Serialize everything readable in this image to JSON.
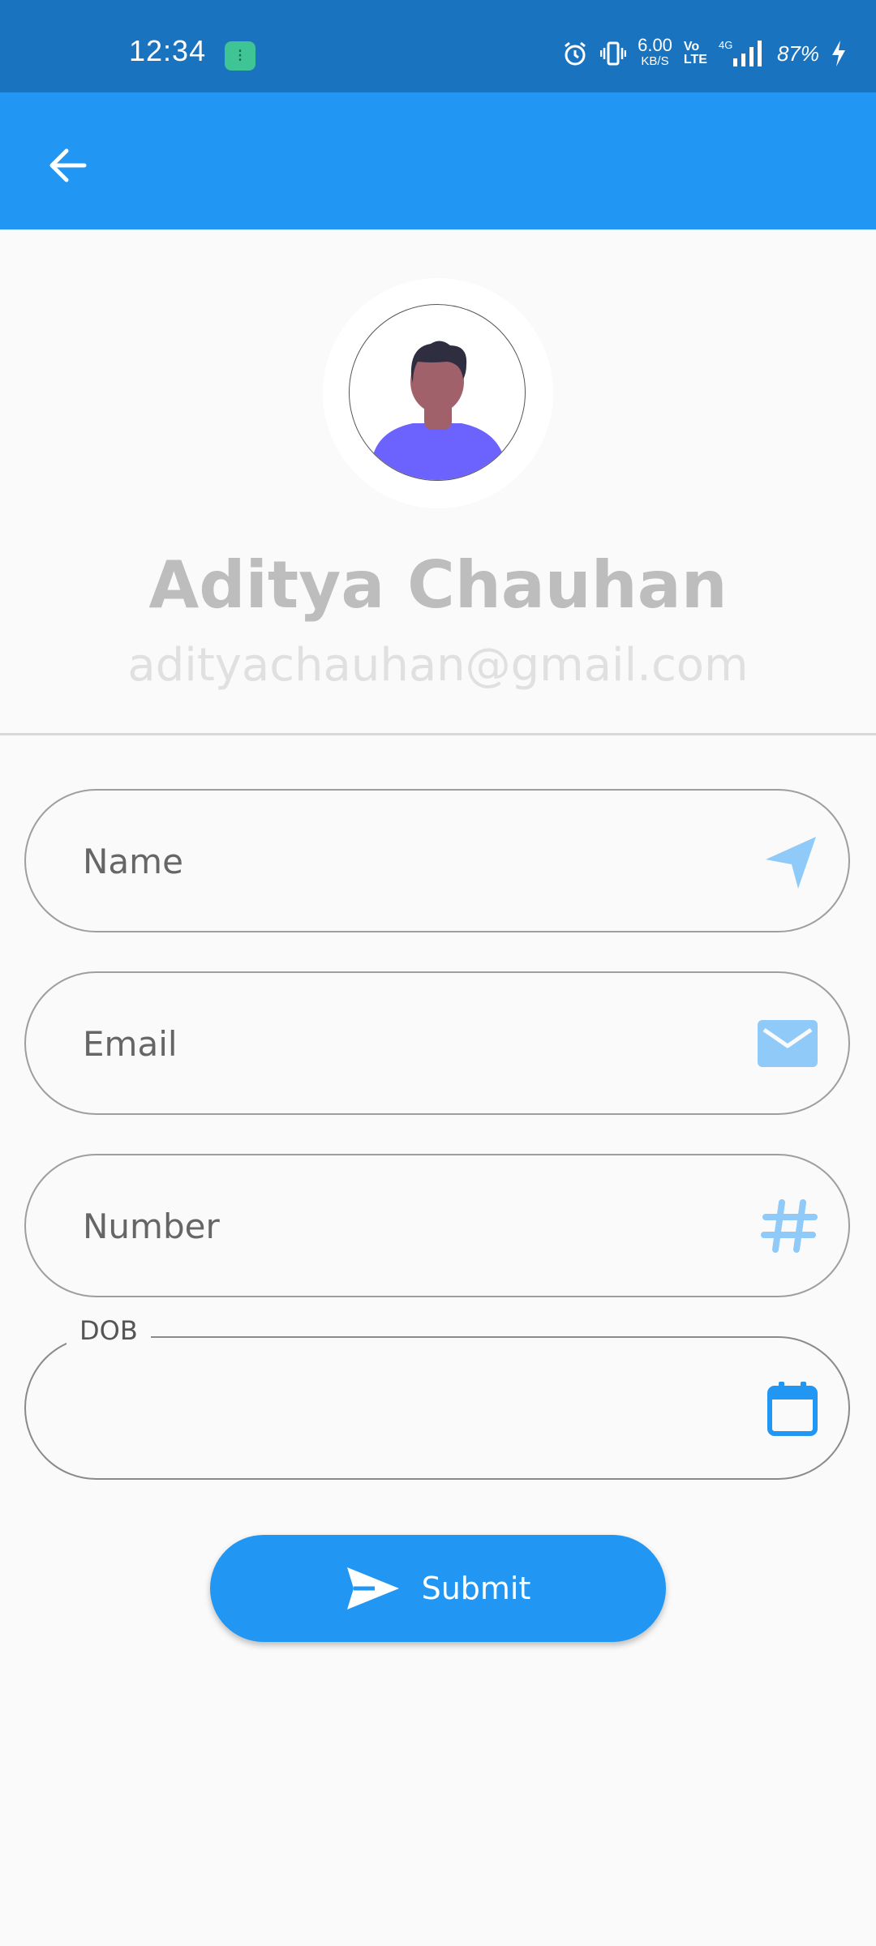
{
  "status_bar": {
    "time": "12:34",
    "net_speed_value": "6.00",
    "net_speed_unit": "KB/S",
    "volte_label": "Vo\nLTE",
    "network_type": "4G",
    "battery": "87%",
    "icons": [
      "app-notification-icon",
      "alarm-icon",
      "vibrate-icon",
      "signal-icon",
      "charging-icon"
    ]
  },
  "app_bar": {
    "back_icon": "arrow-back-icon"
  },
  "profile": {
    "name": "Aditya Chauhan",
    "email": "adityachauhan@gmail.com"
  },
  "form": {
    "name_placeholder": "Name",
    "email_placeholder": "Email",
    "number_placeholder": "Number",
    "dob_label": "DOB",
    "dob_value": "",
    "icons": {
      "name": "navigation-arrow-icon",
      "email": "mail-icon",
      "number": "hash-icon",
      "dob": "calendar-icon"
    },
    "submit_label": "Submit"
  },
  "colors": {
    "status_bar": "#1a73bf",
    "app_bar": "#2196f3",
    "accent": "#2196f3",
    "accent_light": "#90caf9",
    "name_text": "#bdbdbd",
    "email_text": "#e0e0e0"
  }
}
